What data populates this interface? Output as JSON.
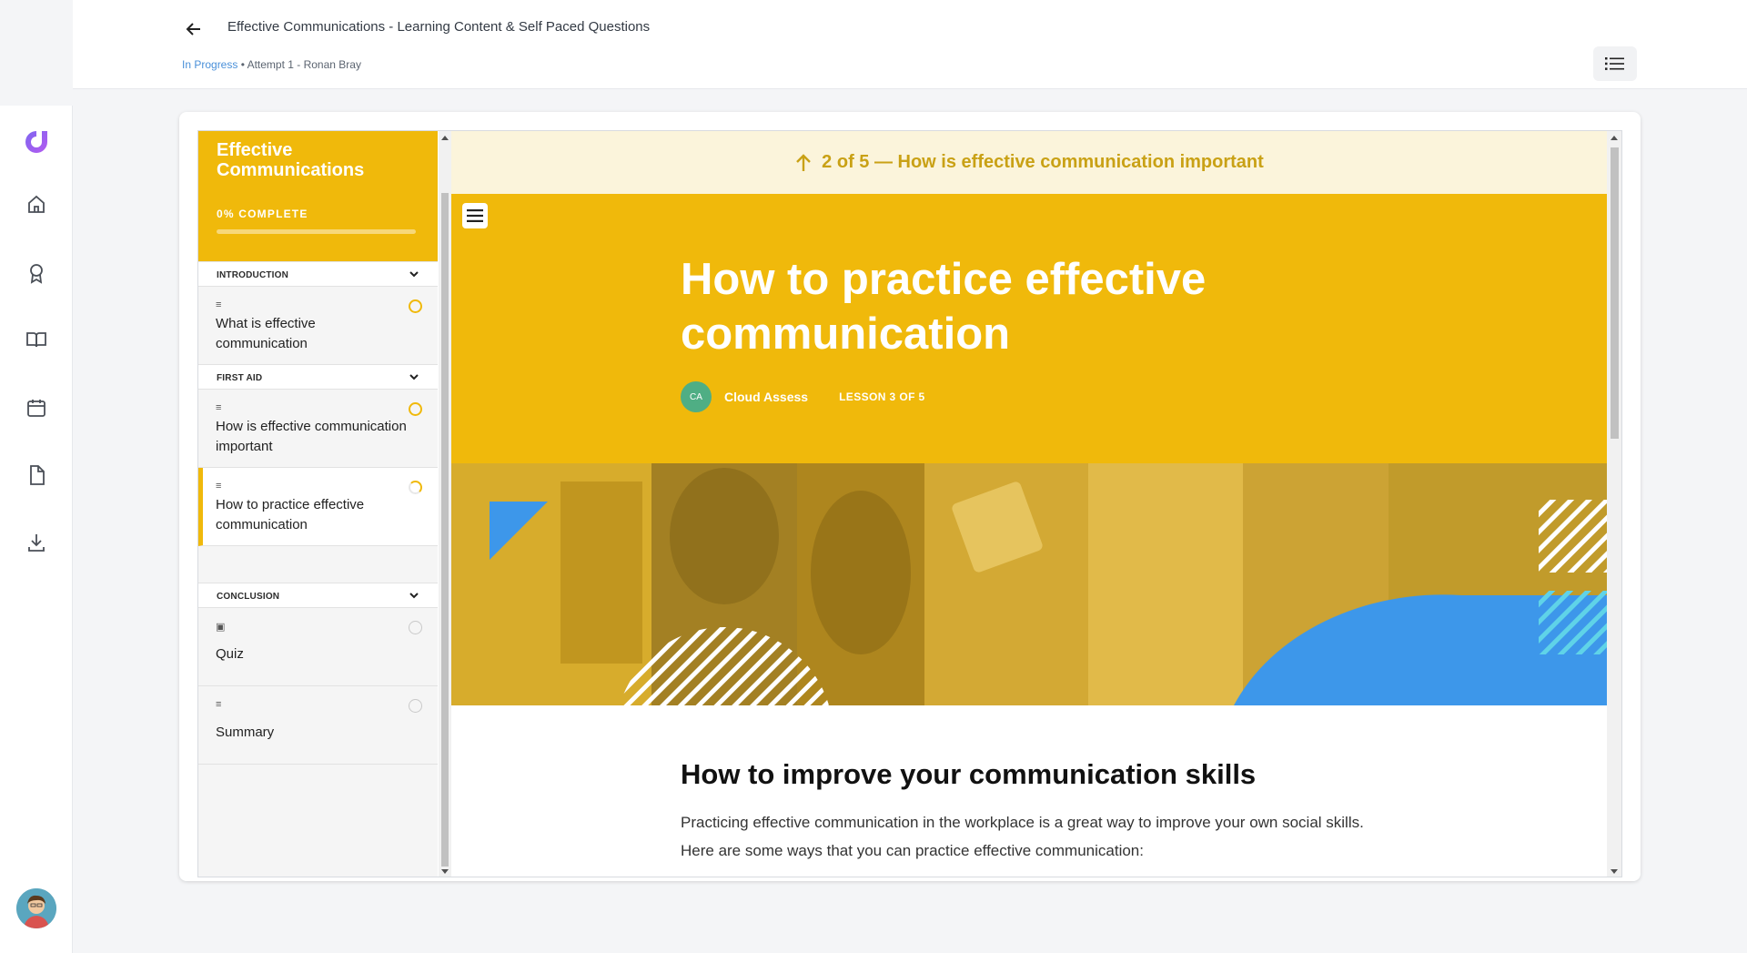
{
  "header": {
    "title": "Effective Communications - Learning Content & Self Paced Questions",
    "status": "In Progress",
    "meta": " • Attempt 1 - Ronan Bray"
  },
  "rail": {
    "icons": [
      "logo-icon",
      "home-icon",
      "award-icon",
      "book-icon",
      "calendar-icon",
      "document-icon",
      "download-icon"
    ]
  },
  "course": {
    "title": "Effective Communications",
    "progress_label": "0% COMPLETE",
    "progress": 0,
    "sections": [
      {
        "label": "INTRODUCTION",
        "lessons": [
          {
            "title": "What is effective communication",
            "status": "in-progress"
          }
        ]
      },
      {
        "label": "FIRST AID",
        "lessons": [
          {
            "title": "How is effective communication important",
            "status": "in-progress"
          },
          {
            "title": "How to practice effective communication",
            "status": "active"
          }
        ]
      },
      {
        "label": "CONCLUSION",
        "lessons": [
          {
            "title": "Quiz",
            "status": "not-started"
          },
          {
            "title": "Summary",
            "status": "not-started"
          }
        ]
      }
    ]
  },
  "content": {
    "prev_nav": "2 of 5 — How is effective communication important",
    "lesson_title": "How to practice effective communication",
    "author_initials": "CA",
    "author_name": "Cloud Assess",
    "lesson_count": "LESSON 3 OF 5",
    "heading": "How to improve your communication skills",
    "paragraph": "Practicing effective communication in the workplace is a great way to improve your own social skills. Here are some ways that you can practice effective communication:"
  },
  "colors": {
    "accent": "#f0b90b",
    "blue_shape": "#3d97ea",
    "status_link": "#4a90d9"
  }
}
